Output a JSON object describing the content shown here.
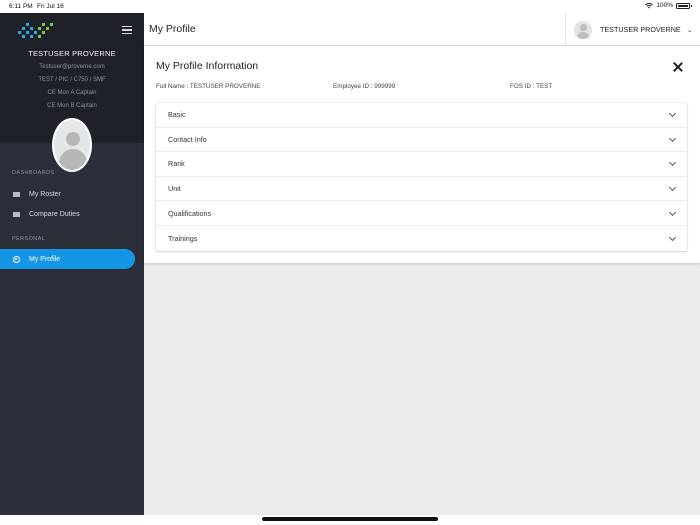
{
  "status_bar": {
    "time": "6:11 PM",
    "date": "Fri Jul 16",
    "battery": "100%"
  },
  "sidebar": {
    "user_name": "TESTUSER PROVERNE",
    "email": "Testuser@proverne.com",
    "details": "TEST / PIC / C750 / SMF",
    "roles": [
      "CE Mon A Captain",
      "CE Mon B Captain"
    ],
    "sections": [
      {
        "label": "DASHBOARDS",
        "items": [
          {
            "label": "My Roster",
            "icon": "list-icon"
          },
          {
            "label": "Compare Duties",
            "icon": "list-icon"
          }
        ]
      },
      {
        "label": "PERSONAL",
        "items": [
          {
            "label": "My Profile",
            "icon": "profile-icon",
            "active": true
          }
        ]
      }
    ]
  },
  "header": {
    "title": "My Profile",
    "user_name": "TESTUSER PROVERNE"
  },
  "profile": {
    "title": "My Profile Information",
    "full_name": "Full Name : TESTUSER PROVERNE",
    "employee_id": "Employee ID : 999999",
    "fos_id": "FOS ID : TEST",
    "sections": [
      "Basic",
      "Contact Info",
      "Rank",
      "Unit",
      "Qualifications",
      "Trainings"
    ]
  },
  "colors": {
    "sidebar_bg": "#2b2f3a",
    "sidebar_top_bg": "#1e2128",
    "accent": "#1595e6"
  }
}
